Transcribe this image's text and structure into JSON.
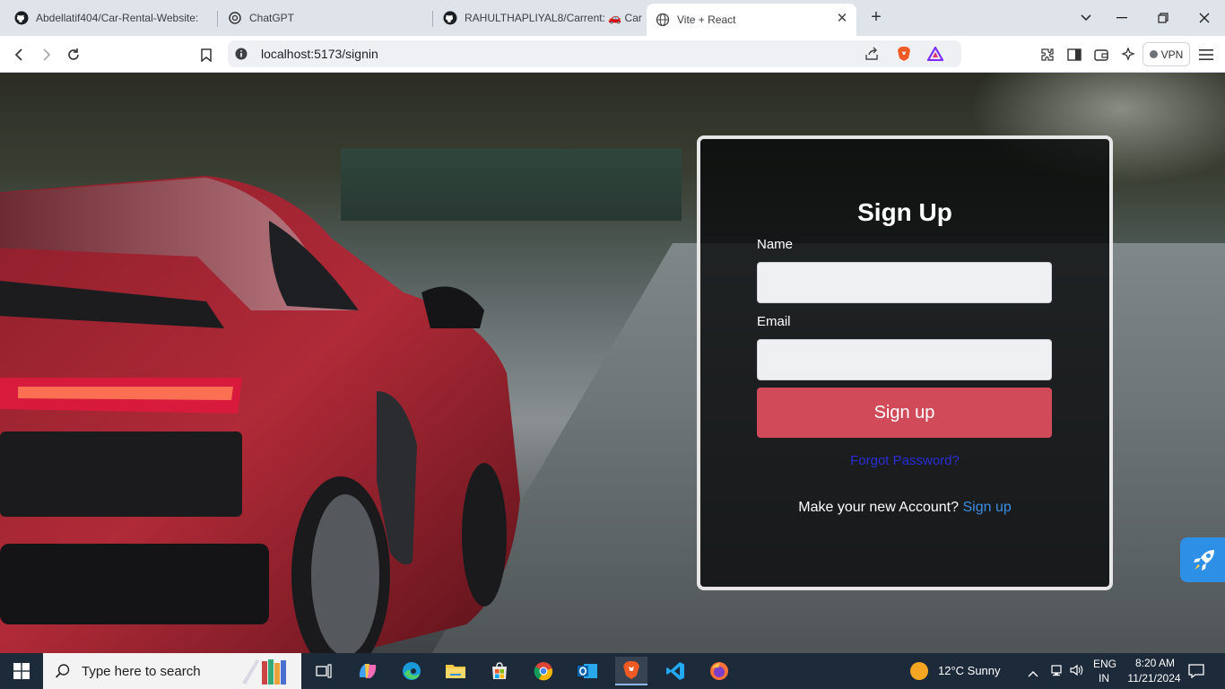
{
  "browser": {
    "tabs": [
      {
        "title": "Abdellatif404/Car-Rental-Website:",
        "icon": "github-icon",
        "active": false
      },
      {
        "title": "ChatGPT",
        "icon": "chatgpt-icon",
        "active": false
      },
      {
        "title": "RAHULTHAPLIYAL8/Carrent: 🚗 Car",
        "icon": "github-icon",
        "active": false
      },
      {
        "title": "Vite + React",
        "icon": "globe-icon",
        "active": true
      }
    ],
    "new_tab": "+",
    "url": "localhost:5173/signin",
    "vpn_label": "VPN"
  },
  "form": {
    "title": "Sign Up",
    "name_label": "Name",
    "name_value": "",
    "email_label": "Email",
    "email_value": "",
    "submit_label": "Sign up",
    "forgot_label": "Forgot Password?",
    "account_prompt": "Make your new Account?",
    "account_link": "Sign up"
  },
  "taskbar": {
    "search_placeholder": "Type here to search",
    "weather": "12°C  Sunny",
    "language_top": "ENG",
    "language_bottom": "IN",
    "time": "8:20 AM",
    "date": "11/21/2024"
  },
  "colors": {
    "button": "#d04a5a",
    "forgot_link": "#2a2dd6",
    "signup_link": "#3b8ee8",
    "taskbar": "#1c2a3a"
  }
}
